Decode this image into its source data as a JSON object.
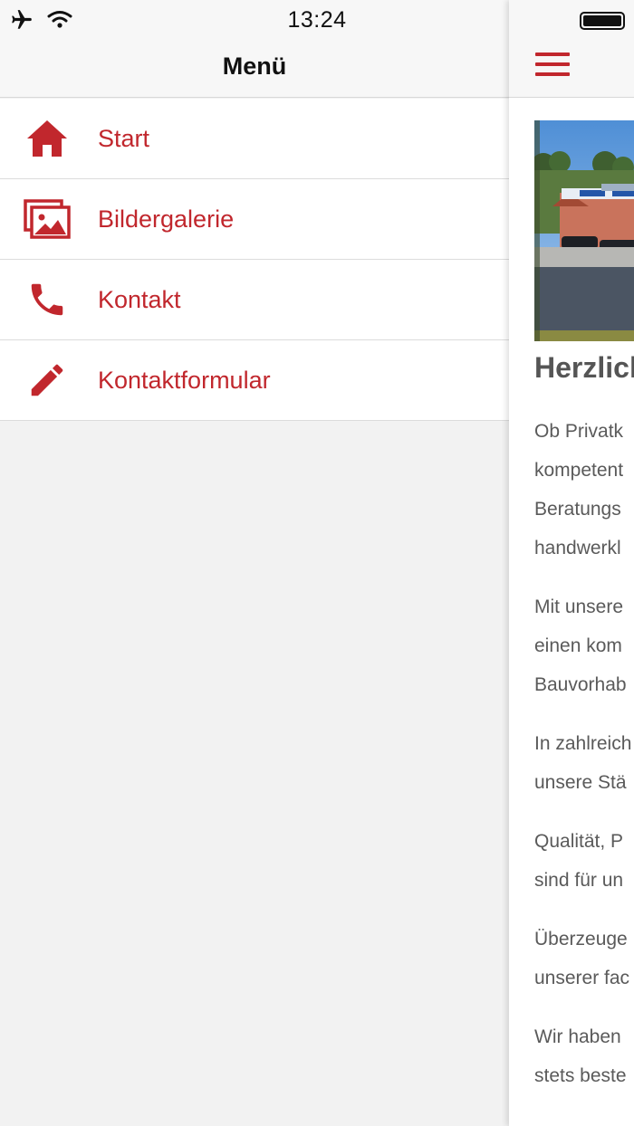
{
  "status": {
    "time": "13:24"
  },
  "menu": {
    "title": "Menü",
    "items": [
      {
        "label": "Start",
        "icon": "home-icon"
      },
      {
        "label": "Bildergalerie",
        "icon": "gallery-icon"
      },
      {
        "label": "Kontakt",
        "icon": "phone-icon"
      },
      {
        "label": "Kontaktformular",
        "icon": "pencil-icon"
      }
    ]
  },
  "page": {
    "title": "Herzlich",
    "paragraphs": [
      [
        "Ob Privatk",
        "kompetent",
        "Beratungs",
        "handwerkl"
      ],
      [
        "Mit unsere",
        "einen kom",
        "Bauvorhab"
      ],
      [
        "In zahlreich",
        "unsere Stä"
      ],
      [
        "Qualität, P",
        "sind für un"
      ],
      [
        "Überzeuge",
        "unserer fac"
      ],
      [
        "Wir haben",
        "stets beste"
      ]
    ]
  },
  "colors": {
    "accent": "#c1272d",
    "background": "#f2f2f2",
    "bar": "#f7f7f7"
  }
}
